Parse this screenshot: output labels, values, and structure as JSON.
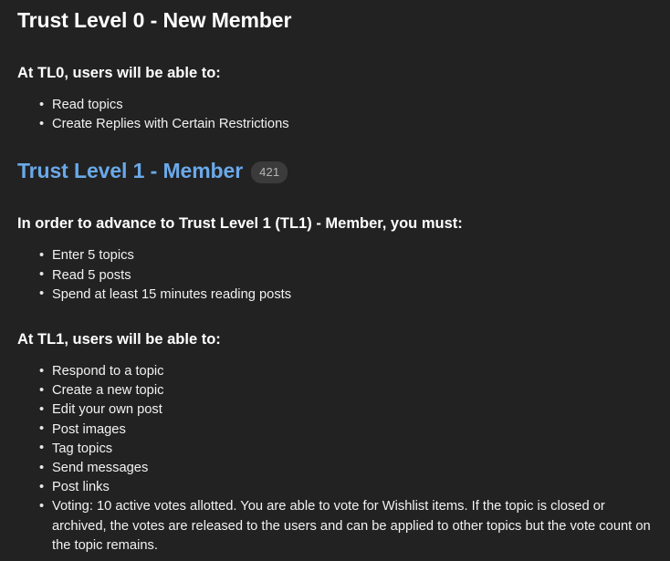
{
  "page": {
    "background_color": "#222222",
    "text_color": "#ffffff",
    "link_color": "#6aa9e9",
    "badge_bg_color": "#3b3b3b",
    "badge_text_color": "#b5b5b5"
  },
  "sections": [
    {
      "title": "Trust Level 0 - New Member",
      "is_link": false,
      "badge": null,
      "groups": [
        {
          "heading": "At TL0, users will be able to:",
          "items": [
            "Read topics",
            "Create Replies with Certain Restrictions"
          ]
        }
      ]
    },
    {
      "title": "Trust Level 1 - Member",
      "is_link": true,
      "badge": "421",
      "groups": [
        {
          "heading": "In order to advance to Trust Level 1 (TL1) - Member, you must:",
          "items": [
            "Enter 5 topics",
            "Read 5 posts",
            "Spend at least 15 minutes reading posts"
          ]
        },
        {
          "heading": "At TL1, users will be able to:",
          "items": [
            "Respond to a topic",
            "Create a new topic",
            "Edit your own post",
            "Post images",
            "Tag topics",
            "Send messages",
            "Post links",
            "Voting: 10 active votes allotted. You are able to vote for Wishlist items. If the topic is closed or archived, the votes are released to the users and can be applied to other topics but the vote count on the topic remains."
          ]
        }
      ]
    }
  ]
}
